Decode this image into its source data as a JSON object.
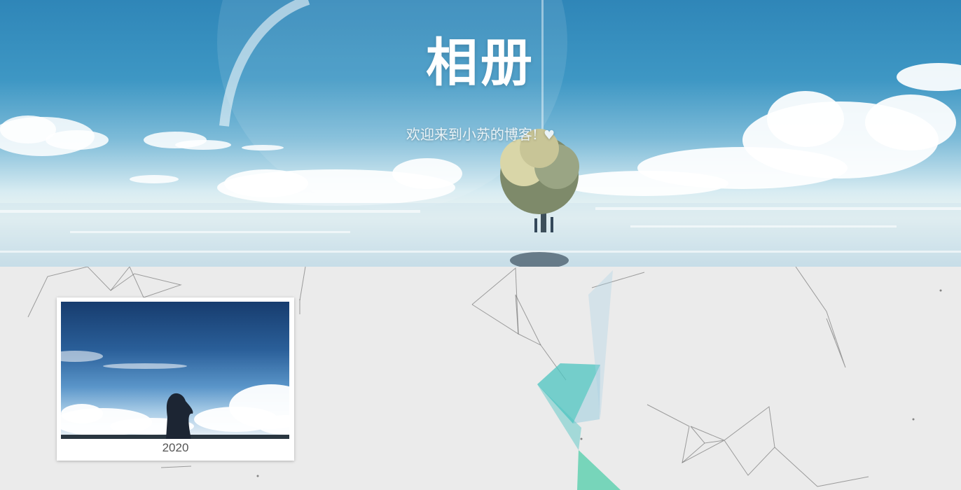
{
  "header": {
    "title": "相册",
    "subtitle": "欢迎来到小苏的博客!",
    "heart_icon": "♥"
  },
  "albums": [
    {
      "caption": "2020",
      "cover_icon": "album-cover-image"
    }
  ],
  "colors": {
    "page_background": "#ebebeb",
    "sky_top": "#2f86b8",
    "card_background": "#ffffff",
    "caption_text": "#555555",
    "accent_polygon": "#4cc4c0"
  }
}
